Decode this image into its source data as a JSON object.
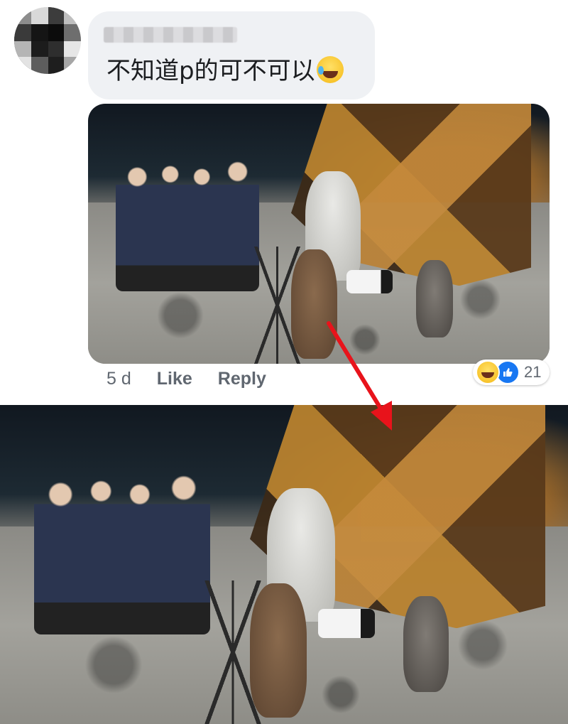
{
  "comment": {
    "text": "不知道p的可不可以",
    "emoji": "tears-of-joy-emoji"
  },
  "actions": {
    "time": "5 d",
    "like_label": "Like",
    "reply_label": "Reply"
  },
  "reactions": {
    "icons": [
      "haha-reaction-icon",
      "like-reaction-icon"
    ],
    "count": "21"
  },
  "colors": {
    "bubble": "#eff1f4",
    "like_blue": "#1877f2",
    "arrow": "#e8131b",
    "meta_text": "#606770"
  }
}
